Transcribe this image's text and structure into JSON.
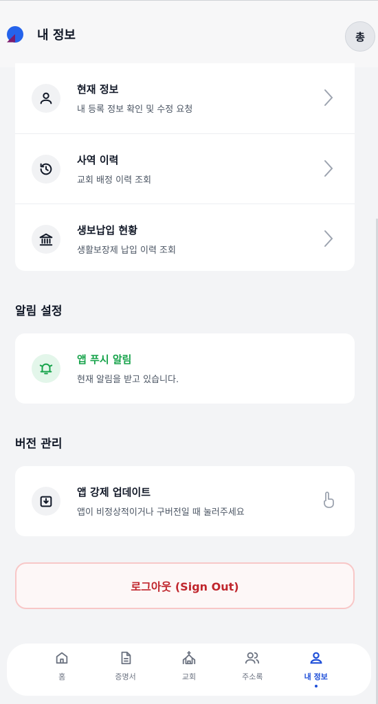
{
  "header": {
    "title": "내 정보",
    "avatar_text": "총"
  },
  "account_menu": [
    {
      "title": "현재 정보",
      "subtitle": "내 등록 정보 확인 및 수정 요청",
      "icon": "user-icon"
    },
    {
      "title": "사역 이력",
      "subtitle": "교회 배정 이력 조회",
      "icon": "history-icon"
    },
    {
      "title": "생보납입 현황",
      "subtitle": "생활보장제 납입 이력 조회",
      "icon": "bank-icon"
    }
  ],
  "notifications": {
    "section_title": "알림 설정",
    "push": {
      "title": "앱 푸시 알림",
      "subtitle": "현재 알림을 받고 있습니다.",
      "icon": "bell-ringing-icon"
    }
  },
  "version": {
    "section_title": "버전 관리",
    "update": {
      "title": "앱 강제 업데이트",
      "subtitle": "앱이 비정상적이거나 구버전일 때 눌러주세요",
      "icon": "download-icon",
      "action_icon": "tap-hand-icon"
    }
  },
  "logout": {
    "label": "로그아웃 (Sign Out)"
  },
  "bottom_nav": [
    {
      "label": "홈",
      "icon": "home-icon",
      "active": false
    },
    {
      "label": "증명서",
      "icon": "document-icon",
      "active": false
    },
    {
      "label": "교회",
      "icon": "church-icon",
      "active": false
    },
    {
      "label": "주소록",
      "icon": "contacts-icon",
      "active": false
    },
    {
      "label": "내 정보",
      "icon": "user-icon",
      "active": true
    }
  ],
  "colors": {
    "accent": "#1d4ed8",
    "success": "#16a34a",
    "danger": "#c0262d"
  }
}
